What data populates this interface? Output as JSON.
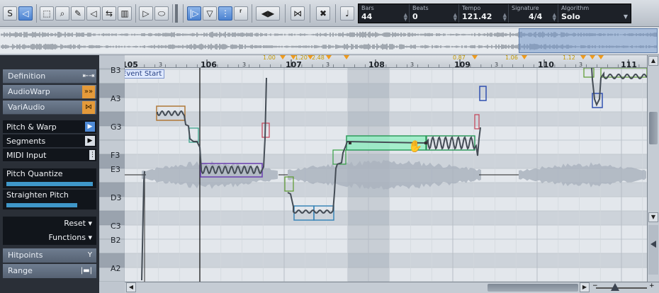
{
  "toolbar": {
    "tools": [
      {
        "name": "solo",
        "glyph": "S",
        "active": false
      },
      {
        "name": "audition-icon",
        "glyph": "◁",
        "active": true
      },
      {
        "name": "select-icon",
        "glyph": "⬚",
        "active": false
      },
      {
        "name": "zoom-icon",
        "glyph": "⌕",
        "active": false
      },
      {
        "name": "draw-icon",
        "glyph": "✎",
        "active": false
      },
      {
        "name": "play-icon",
        "glyph": "▷",
        "active": false
      },
      {
        "name": "loop-icon",
        "glyph": "⬭",
        "active": false
      },
      {
        "name": "snap-icon",
        "glyph": "|▷",
        "active": true
      },
      {
        "name": "quantize-icon",
        "glyph": "▽",
        "active": false
      },
      {
        "name": "grid-icon",
        "glyph": "⋮",
        "active": true
      },
      {
        "name": "bracket-icon",
        "glyph": "⸢",
        "active": false
      },
      {
        "name": "split-icon",
        "glyph": "◀▶",
        "active": false
      },
      {
        "name": "warp-icon",
        "glyph": "✖",
        "active": false
      },
      {
        "name": "note-icon",
        "glyph": "♩",
        "active": false
      }
    ],
    "info": {
      "bars_label": "Bars",
      "bars_value": "44",
      "beats_label": "Beats",
      "beats_value": "0",
      "tempo_label": "Tempo",
      "tempo_value": "121.42",
      "signature_label": "Signature",
      "signature_value": "4/4",
      "algorithm_label": "Algorithm",
      "algorithm_value": "Solo"
    }
  },
  "left_panel": {
    "definition": "Definition",
    "audiowarp": "AudioWarp",
    "variaudio": "VariAudio",
    "pitch_warp": "Pitch & Warp",
    "segments": "Segments",
    "midi_input": "MIDI Input",
    "pitch_quantize": "Pitch Quantize",
    "pitch_quantize_level": 1.0,
    "straighten_pitch": "Straighten Pitch",
    "straighten_pitch_level": 0.82,
    "reset": "Reset",
    "functions": "Functions",
    "hitpoints": "Hitpoints",
    "range": "Range"
  },
  "keys": [
    "B3",
    "A3",
    "G3",
    "F3",
    "E3",
    "D3",
    "C3",
    "B2",
    "A2"
  ],
  "ruler": {
    "bars": [
      "105",
      "106",
      "107",
      "108",
      "109",
      "110",
      "111"
    ],
    "beat_labels": [
      "3",
      "3",
      "3",
      "3",
      "3",
      "3"
    ],
    "warp_labels": [
      "1.00",
      "1.20",
      "2.48",
      "0.87",
      "1.06",
      "1.12"
    ]
  },
  "editor": {
    "event_start": "Event Start"
  },
  "colors": {
    "accent_blue": "#4e8ad6",
    "warp_orange": "#f09b1c",
    "segment_selected": "#8ff0c0"
  }
}
